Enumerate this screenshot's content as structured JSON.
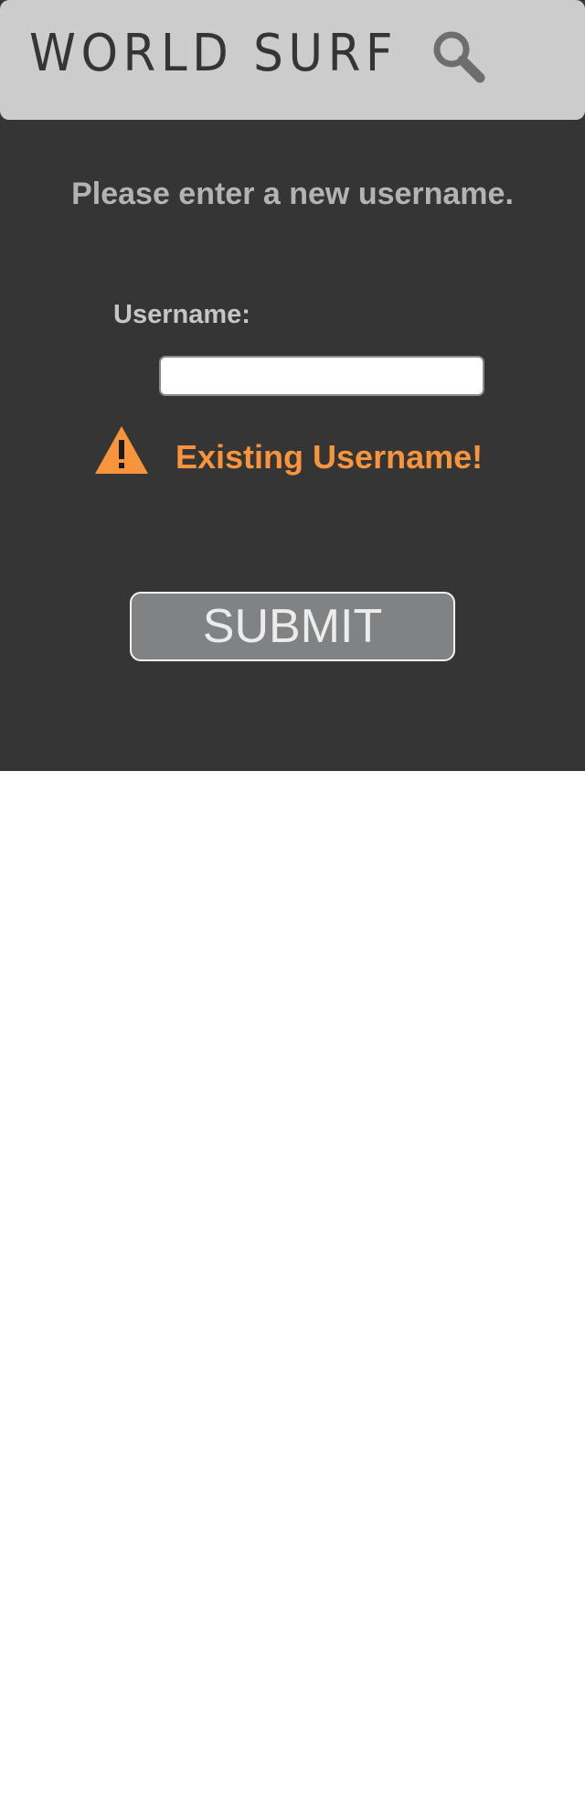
{
  "header": {
    "brand": "WORLD SURF",
    "search_icon": "search-icon"
  },
  "form": {
    "prompt": "Please enter a new username.",
    "username_label": "Username:",
    "username_value": "",
    "username_placeholder": "",
    "error_icon": "warning-icon",
    "error_message": "Existing Username!",
    "submit_label": "SUBMIT"
  },
  "colors": {
    "header_bg": "#cccccc",
    "screen_bg": "#353535",
    "brand_text": "#353535",
    "prompt_text": "#b3b3b3",
    "label_text": "#c6c6c6",
    "error_accent": "#f7943c",
    "button_bg": "#818284",
    "button_text": "#ececec"
  }
}
